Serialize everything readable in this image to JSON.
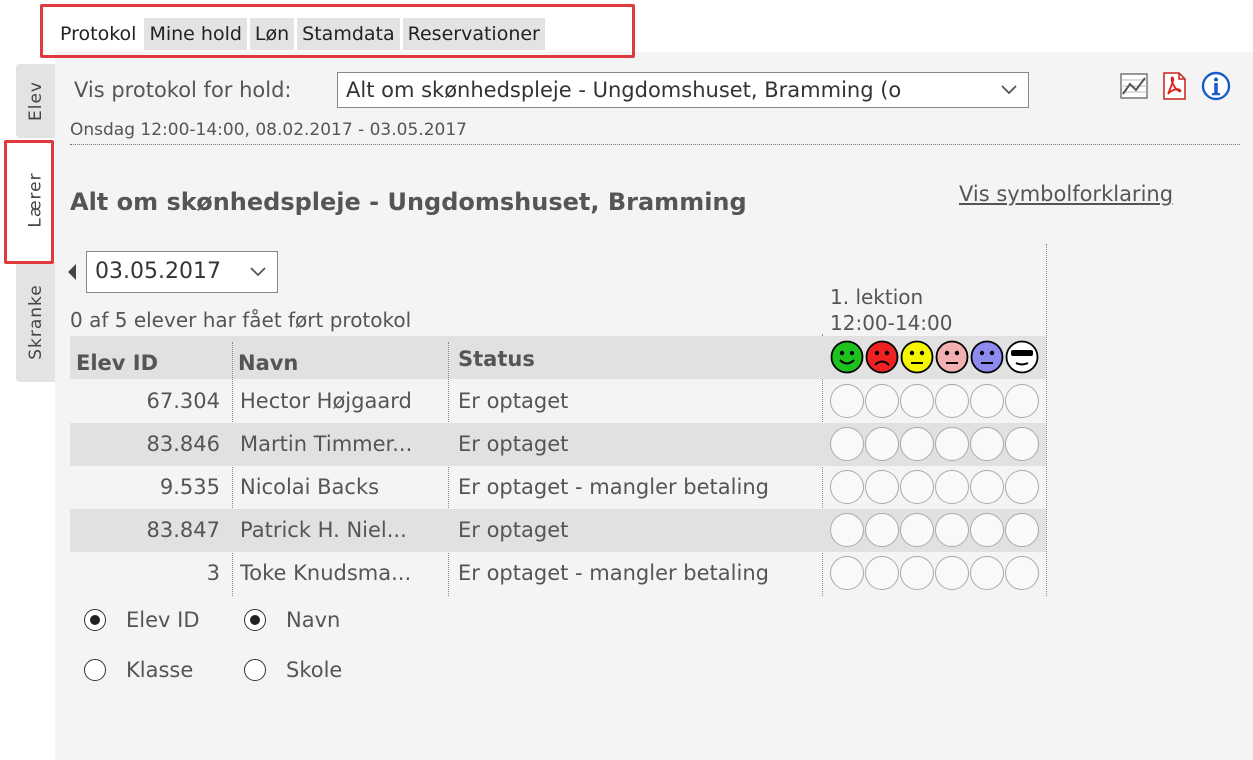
{
  "top_tabs": [
    {
      "label": "Protokol",
      "active": true
    },
    {
      "label": "Mine hold"
    },
    {
      "label": "Løn"
    },
    {
      "label": "Stamdata"
    },
    {
      "label": "Reservationer"
    }
  ],
  "side_tabs": [
    {
      "label": "Elev"
    },
    {
      "label": "Lærer",
      "active": true
    },
    {
      "label": "Skranke"
    }
  ],
  "header": {
    "vis_label": "Vis protokol for hold:",
    "hold_select_value": "Alt om skønhedspleje - Ungdomshuset, Bramming (o",
    "schedule": "Onsdag 12:00-14:00, 08.02.2017 - 03.05.2017",
    "icons": [
      "chart-icon",
      "pdf-icon",
      "info-icon"
    ]
  },
  "title": "Alt om skønhedspleje - Ungdomshuset, Bramming",
  "legend_link": "Vis symbolforklaring",
  "date_select_value": "03.05.2017",
  "count_text": "0 af 5 elever har fået ført protokol",
  "lesson": {
    "line1": "1. lektion",
    "line2": "12:00-14:00"
  },
  "table": {
    "headers": {
      "id": "Elev ID",
      "name": "Navn",
      "status": "Status"
    },
    "header_smileys": [
      {
        "name": "green-smiley-icon",
        "color": "#1ec21e",
        "mood": "happy"
      },
      {
        "name": "red-smiley-icon",
        "color": "#ee2222",
        "mood": "sad"
      },
      {
        "name": "yellow-smiley-icon",
        "color": "#f5f500",
        "mood": "neutral"
      },
      {
        "name": "pink-smiley-icon",
        "color": "#f2b0b0",
        "mood": "neutral"
      },
      {
        "name": "blue-smiley-icon",
        "color": "#8c8cf0",
        "mood": "neutral"
      },
      {
        "name": "sunglasses-smiley-icon",
        "color": "#ffffff",
        "mood": "cool"
      }
    ],
    "rows": [
      {
        "id": "67.304",
        "name": "Hector Højgaard",
        "status": "Er optaget"
      },
      {
        "id": "83.846",
        "name": "Martin Timmer...",
        "status": "Er optaget"
      },
      {
        "id": "9.535",
        "name": "Nicolai Backs",
        "status": "Er optaget - mangler betaling"
      },
      {
        "id": "83.847",
        "name": "Patrick H. Niel...",
        "status": "Er optaget"
      },
      {
        "id": "3",
        "name": "Toke Knudsma...",
        "status": "Er optaget - mangler betaling"
      }
    ]
  },
  "sort_options": [
    {
      "label": "Elev ID",
      "checked": true
    },
    {
      "label": "Navn",
      "checked": true
    },
    {
      "label": "Klasse",
      "checked": false
    },
    {
      "label": "Skole",
      "checked": false
    }
  ]
}
